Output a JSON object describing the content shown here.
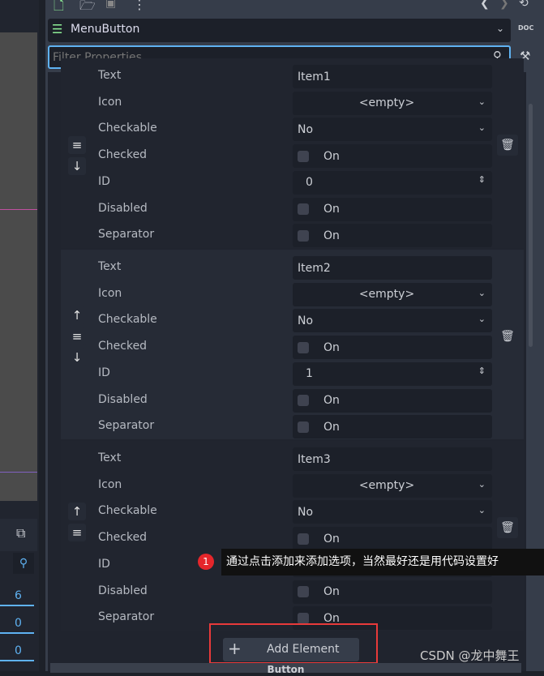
{
  "toolbar": {
    "back": "❮",
    "forward": "❯"
  },
  "node": {
    "name": "MenuButton",
    "doc": "DOC"
  },
  "filter": {
    "placeholder": "Filter Properties"
  },
  "labels": [
    "Text",
    "Icon",
    "Checkable",
    "Checked",
    "ID",
    "Disabled",
    "Separator"
  ],
  "items": [
    {
      "text": "Item1",
      "icon": "<empty>",
      "checkable": "No",
      "checked": "On",
      "id": "0",
      "disabled": "On",
      "separator": "On"
    },
    {
      "text": "Item2",
      "icon": "<empty>",
      "checkable": "No",
      "checked": "On",
      "id": "1",
      "disabled": "On",
      "separator": "On"
    },
    {
      "text": "Item3",
      "icon": "<empty>",
      "checkable": "No",
      "checked": "On",
      "id": "",
      "disabled": "On",
      "separator": "On"
    }
  ],
  "add_element": "Add Element",
  "next_section": "Button",
  "annotation": {
    "badge": "1",
    "text": "通过点击添加来添加选项，当然最好还是用代码设置好"
  },
  "left_counts": [
    "6",
    "0",
    "0"
  ],
  "watermark": "CSDN @龙中舞王",
  "colors": {
    "accent": "#5fb2f2",
    "node_icon": "#8eef97",
    "highlight_box": "#e83a3a",
    "badge": "#e5262b"
  }
}
